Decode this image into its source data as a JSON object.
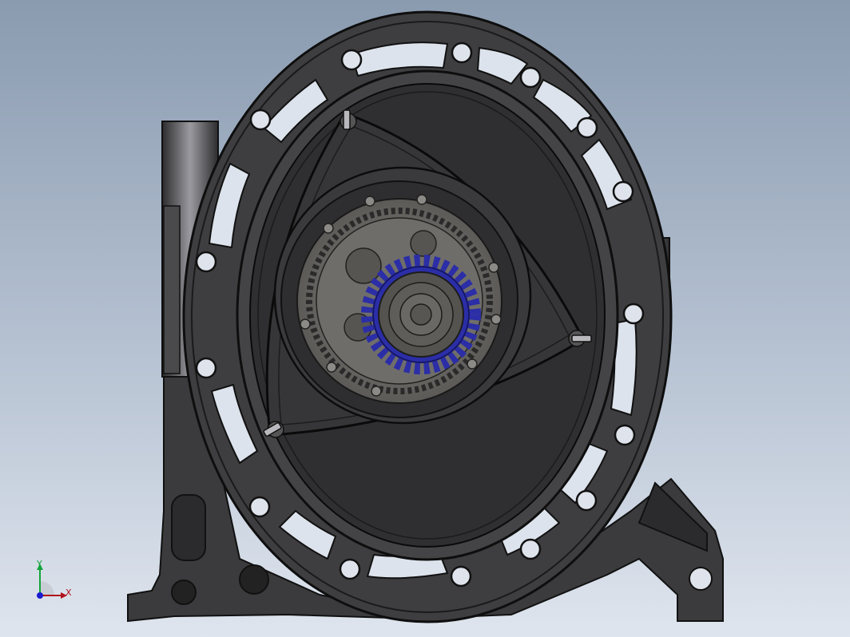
{
  "viewport": {
    "background_top": "#8a9bb0",
    "background_bottom": "#dfe5ee"
  },
  "model": {
    "housing_color": "#3d3d3f",
    "chamber_color": "#2f2f31",
    "rotor_color": "#353537",
    "internal_gear_color": "#6c6a66",
    "pinion_gear_color": "#2b2ea6"
  },
  "triad": {
    "x_label": "X",
    "y_label": "Y",
    "x_color": "#b0101a",
    "y_color": "#13a43a",
    "z_color": "#1a1ad0"
  }
}
